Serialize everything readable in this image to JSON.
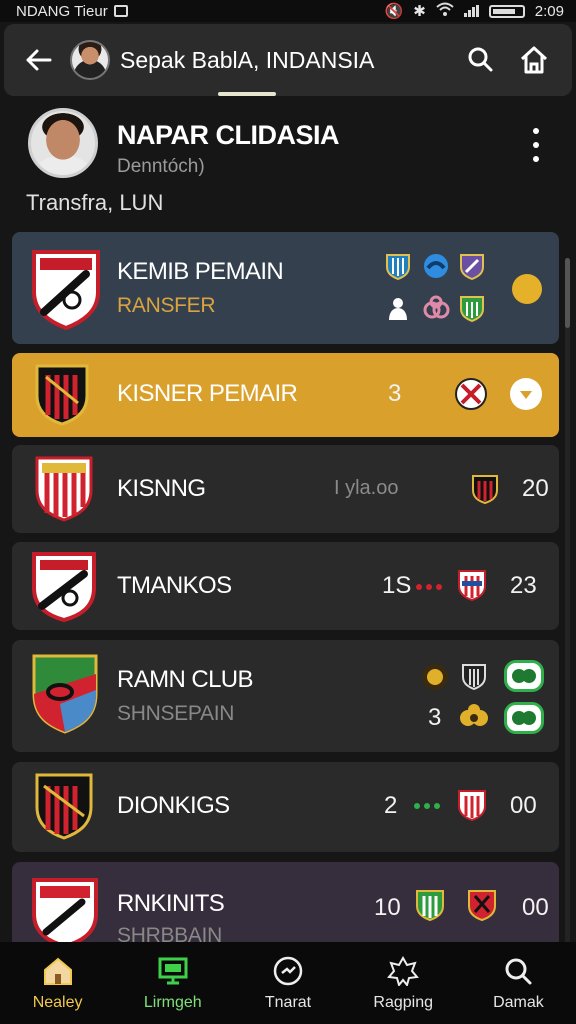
{
  "status_bar": {
    "carrier": "NDANG Tieur",
    "time": "2:09"
  },
  "header": {
    "title": "Sepak BablA, INDANSIA"
  },
  "profile": {
    "name": "NAPAR CLIDASIA",
    "subtitle": "Denntóch)",
    "transfer": "Transfra, LUN"
  },
  "rows": [
    {
      "name": "KEMIB PEMAIN",
      "sub": "RANSFER"
    },
    {
      "name": "KISNER PEMAIR",
      "value": "3"
    },
    {
      "name": "KISNNG",
      "meta": "I yla.oo",
      "value": "20"
    },
    {
      "name": "TMANKOS",
      "value_left": "1S",
      "value": "23"
    },
    {
      "name": "RAMN CLUB",
      "sub": "SHNSEPAIN",
      "value_left": "3"
    },
    {
      "name": "DIONKIGS",
      "value_left": "2",
      "value": "00"
    },
    {
      "name": "RNKINITS",
      "sub": "SHRBBAIN",
      "value_left": "10",
      "value": "00"
    }
  ],
  "colors": {
    "accent_row": "#d9a02c",
    "row_1": "#34404d",
    "row_last": "#372e3d",
    "active_nav": "#f2c94c",
    "green_nav": "#7fe07a"
  },
  "bottom_nav": [
    {
      "label": "Nealey",
      "icon": "home-icon"
    },
    {
      "label": "Lirmgeh",
      "icon": "monitor-icon"
    },
    {
      "label": "Tnarat",
      "icon": "clock-icon"
    },
    {
      "label": "Ragping",
      "icon": "badge-icon"
    },
    {
      "label": "Damak",
      "icon": "search-icon"
    }
  ]
}
